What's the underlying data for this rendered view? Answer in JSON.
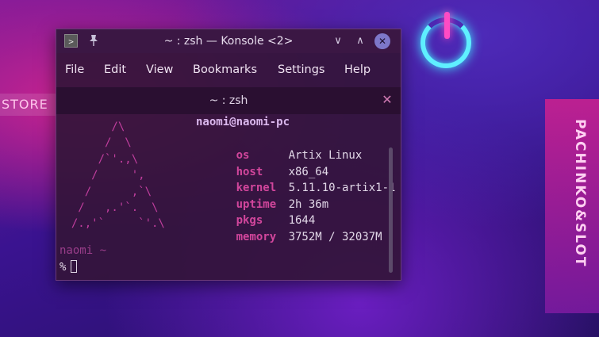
{
  "window": {
    "title": "~ : zsh — Konsole <2>",
    "app_icon_glyph": ">",
    "pin_icon": "pin-icon",
    "minimize_glyph": "∨",
    "maximize_glyph": "∧",
    "close_glyph": "✕"
  },
  "menu": {
    "items": [
      "File",
      "Edit",
      "View",
      "Bookmarks",
      "Settings",
      "Help"
    ]
  },
  "tab": {
    "label": "~ : zsh",
    "close_glyph": "✕"
  },
  "terminal": {
    "logo": "        /\\\n       /  \\\n      /`'.,\\\n     /     ',\n    /      ,`\\\n   /   ,.'`.  \\\n  /.,'`     `'.\\",
    "user_host": "naomi@naomi-pc",
    "info": [
      {
        "key": "os",
        "value": "Artix Linux"
      },
      {
        "key": "host",
        "value": "x86_64"
      },
      {
        "key": "kernel",
        "value": "5.11.10-artix1-1"
      },
      {
        "key": "uptime",
        "value": "2h 36m"
      },
      {
        "key": "pkgs",
        "value": "1644"
      },
      {
        "key": "memory",
        "value": "3752M / 32037M"
      }
    ],
    "prompt_user": "naomi ~",
    "prompt_symbol": "%"
  },
  "wallpaper": {
    "store_sign": "STORE",
    "pachinko_sign": "PACHINKO&SLOT"
  },
  "colors": {
    "accent_magenta": "#d2469c",
    "window_bg": "#34143a",
    "neon_cyan": "#5ff0ff"
  }
}
